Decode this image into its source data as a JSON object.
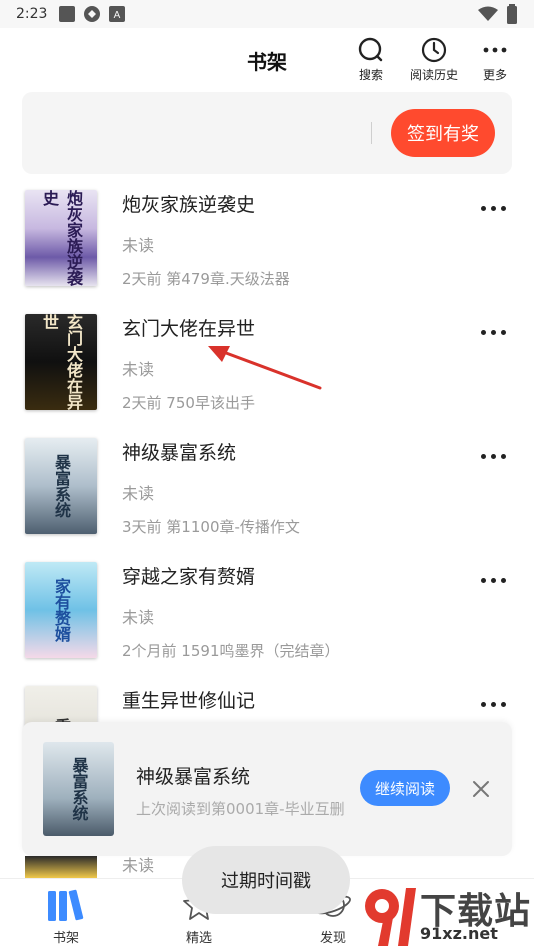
{
  "status_bar": {
    "time": "2:23",
    "app_icon_letter": "A"
  },
  "header": {
    "title": "书架",
    "actions": [
      {
        "label": "搜索",
        "icon": "search-icon"
      },
      {
        "label": "阅读历史",
        "icon": "clock-icon"
      },
      {
        "label": "更多",
        "icon": "more-icon"
      }
    ]
  },
  "signin": {
    "button_label": "签到有奖"
  },
  "books": [
    {
      "title": "炮灰家族逆袭史",
      "status": "未读",
      "update": "2天前 第479章.天级法器",
      "cover_text": "炮灰家族逆袭史"
    },
    {
      "title": "玄门大佬在异世",
      "status": "未读",
      "update": "2天前 750早该出手",
      "cover_text": "玄门大佬在异世"
    },
    {
      "title": "神级暴富系统",
      "status": "未读",
      "update": "3天前 第1100章-传播作文",
      "cover_text": "暴富系统"
    },
    {
      "title": "穿越之家有赘婿",
      "status": "未读",
      "update": "2个月前 1591鸣墨界（完结章）",
      "cover_text": "家有赘婿"
    },
    {
      "title": "重生异世修仙记",
      "status": "",
      "update": "",
      "cover_text": "重生"
    }
  ],
  "continue_reading": {
    "title": "神级暴富系统",
    "subtitle": "上次阅读到第0001章-毕业互删",
    "button_label": "继续阅读",
    "cover_text": "暴富系统"
  },
  "hidden_status": "未读",
  "toast": {
    "text": "过期时间戳"
  },
  "bottom_nav": [
    {
      "label": "书架",
      "icon": "bookshelf-icon",
      "active": true
    },
    {
      "label": "精选",
      "icon": "star-icon",
      "active": false
    },
    {
      "label": "发现",
      "icon": "planet-icon",
      "active": false
    }
  ],
  "watermark": {
    "text": "下载站",
    "url": "91xz.net"
  },
  "colors": {
    "accent_red": "#ff4a2e",
    "accent_blue": "#3d8bff",
    "arrow": "#d9322b"
  }
}
